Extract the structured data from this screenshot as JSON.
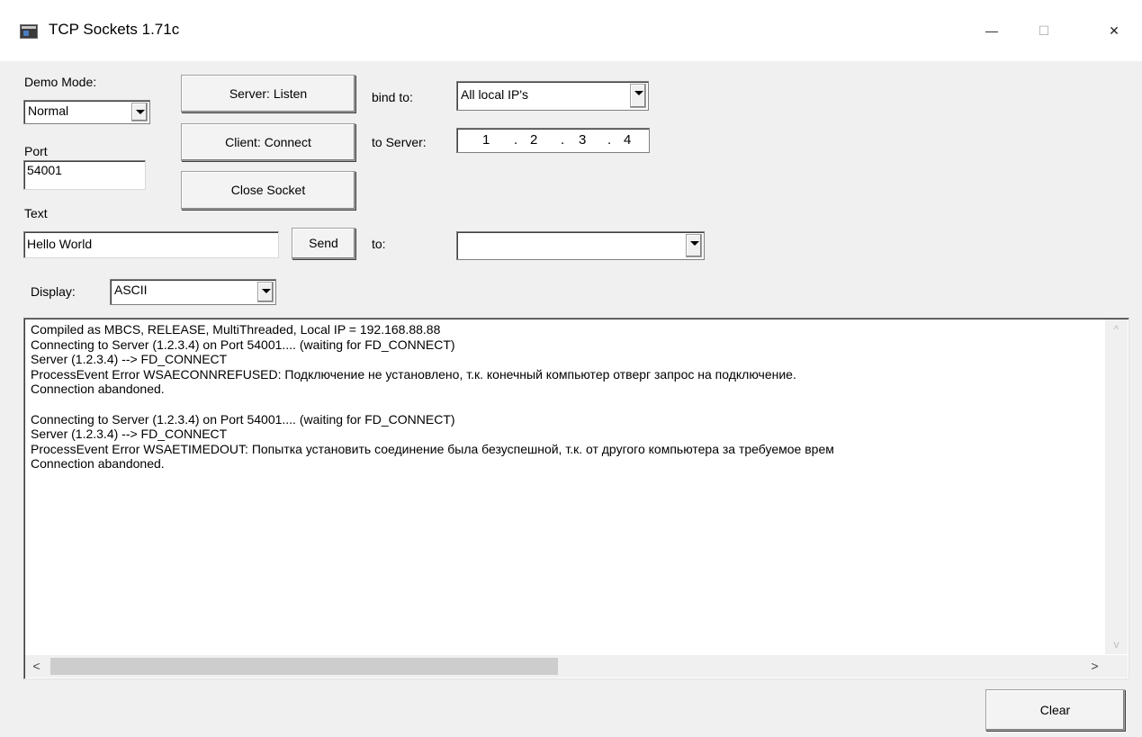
{
  "window": {
    "title": "TCP Sockets 1.71c",
    "minimize": "—",
    "maximize": "☐",
    "close": "✕"
  },
  "controls": {
    "demo_mode_label": "Demo Mode:",
    "demo_mode_value": "Normal",
    "port_label": "Port",
    "port_value": "54001",
    "text_label": "Text",
    "text_value": "Hello World",
    "display_label": "Display:",
    "display_value": "ASCII",
    "server_listen": "Server: Listen",
    "client_connect": "Client: Connect",
    "close_socket": "Close Socket",
    "send": "Send",
    "bind_to_label": "bind to:",
    "bind_to_value": "All local IP's",
    "to_server_label": "to Server:",
    "ip": [
      "1",
      "2",
      "3",
      "4"
    ],
    "to_label": "to:",
    "to_value": ""
  },
  "log": {
    "lines": "Compiled as MBCS, RELEASE, MultiThreaded, Local IP = 192.168.88.88\nConnecting to Server (1.2.3.4) on Port 54001.... (waiting for FD_CONNECT)\nServer (1.2.3.4) --> FD_CONNECT\nProcessEvent Error WSAECONNREFUSED: Подключение не установлено, т.к. конечный компьютер отверг запрос на подключение.\nConnection abandoned.\n\nConnecting to Server (1.2.3.4) on Port 54001.... (waiting for FD_CONNECT)\nServer (1.2.3.4) --> FD_CONNECT\nProcessEvent Error WSAETIMEDOUT: Попытка установить соединение была безуспешной, т.к. от другого компьютера за требуемое врем\nConnection abandoned."
  },
  "footer": {
    "clear": "Clear"
  },
  "icons": {
    "scroll_up": "^",
    "scroll_down": "v",
    "scroll_left": "<",
    "scroll_right": ">"
  }
}
